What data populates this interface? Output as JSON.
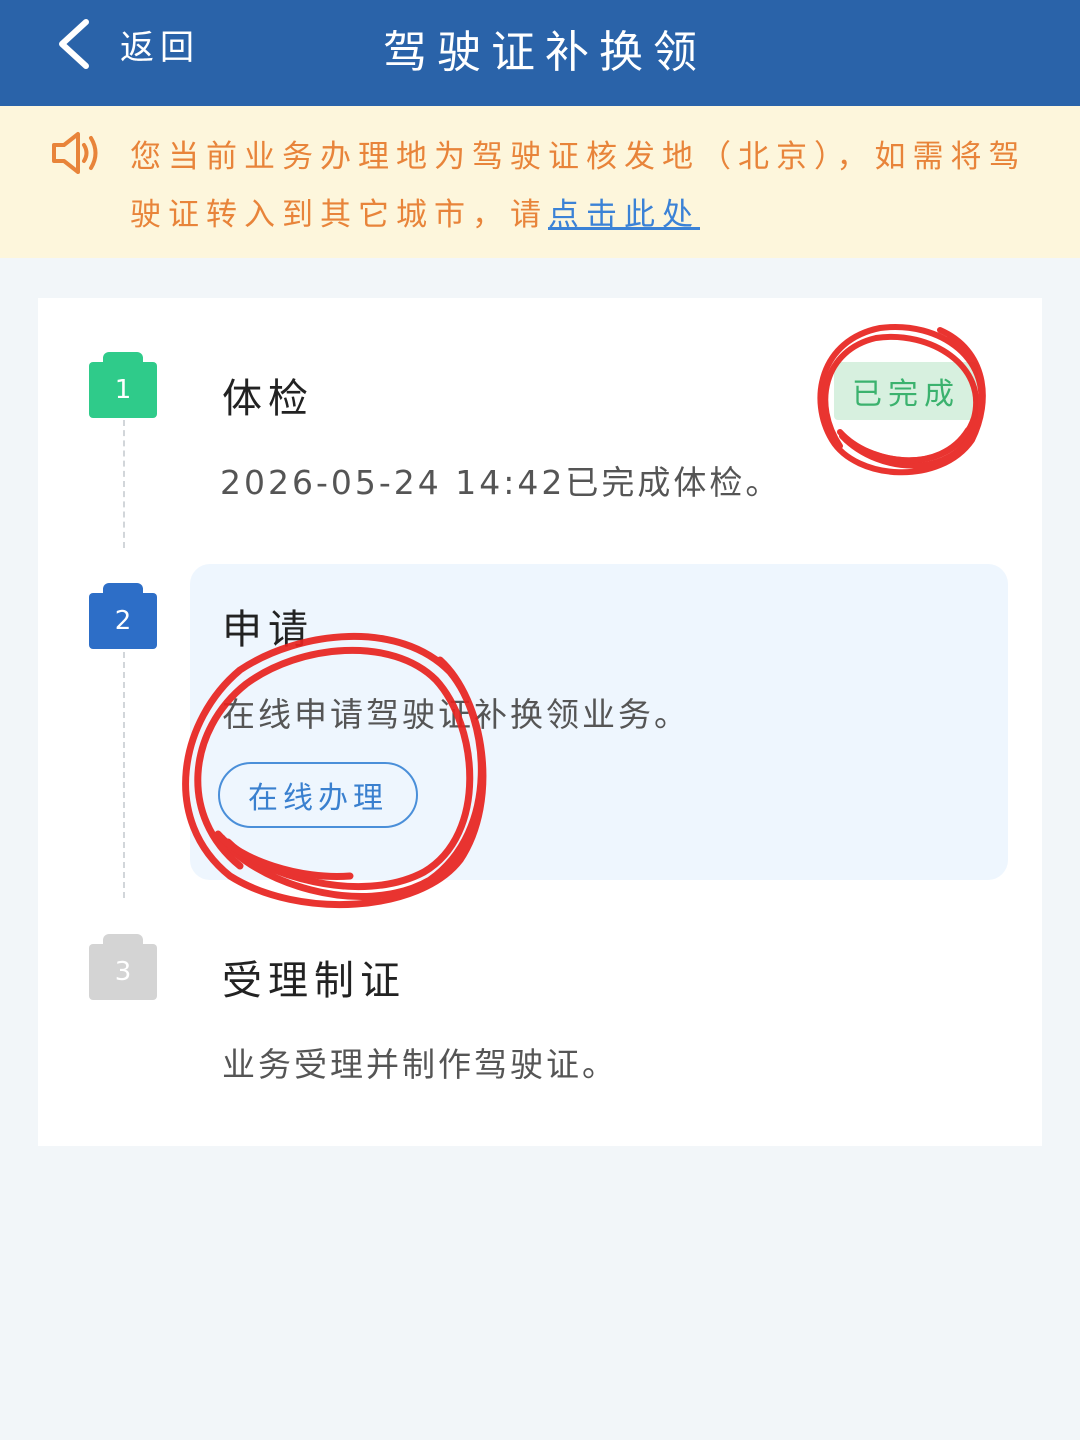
{
  "header": {
    "back_label": "返回",
    "title": "驾驶证补换领"
  },
  "notice": {
    "icon": "speaker-icon",
    "text": "您当前业务办理地为驾驶证核发地（北京），如需将驾驶证转入到其它城市，请",
    "link_text": "点击此处"
  },
  "steps": [
    {
      "number": "1",
      "title": "体检",
      "description": "2026-05-24 14:42已完成体检。",
      "status": "已完成",
      "color": "#2fcb8a"
    },
    {
      "number": "2",
      "title": "申请",
      "description": "在线申请驾驶证补换领业务。",
      "action_label": "在线办理",
      "color": "#2d6ec7"
    },
    {
      "number": "3",
      "title": "受理制证",
      "description": "业务受理并制作驾驶证。",
      "color": "#d4d4d4"
    }
  ],
  "colors": {
    "header_bg": "#2a63a9",
    "notice_bg": "#fdf6dc",
    "notice_text": "#e8843a",
    "link": "#3b82d6",
    "annotation": "#e8231f"
  }
}
